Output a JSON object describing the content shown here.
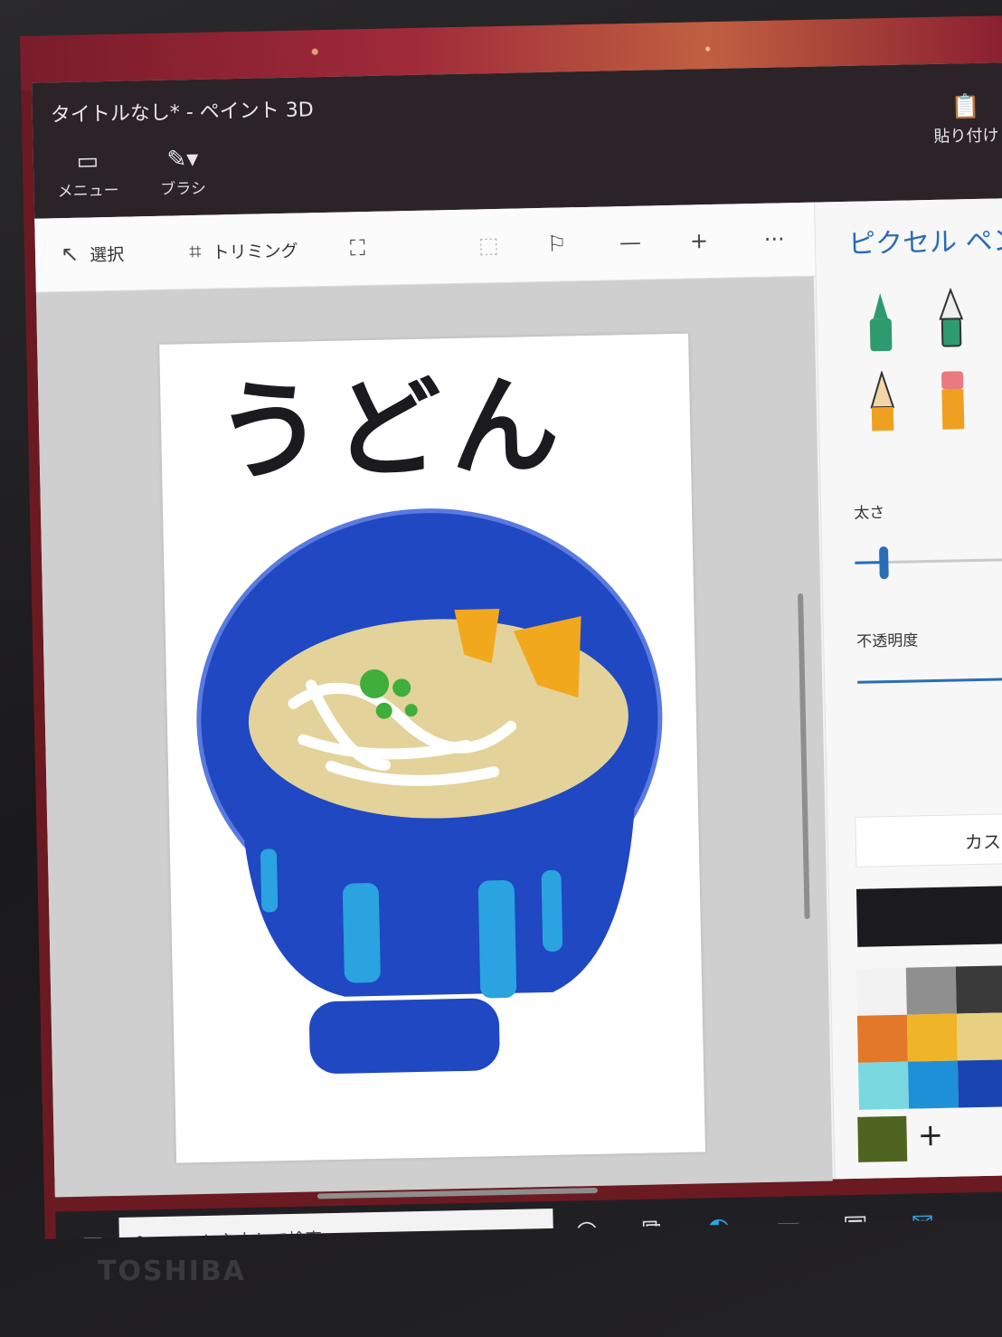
{
  "window": {
    "title": "タイトルなし* - ペイント 3D"
  },
  "ribbon": {
    "menu_label": "メニュー",
    "brush_label": "ブラシ",
    "paste_label": "貼り付け"
  },
  "toolbar": {
    "select_label": "選択",
    "crop_label": "トリミング",
    "more_label": "···"
  },
  "canvas": {
    "drawing_text": "うどん"
  },
  "panel": {
    "title": "ピクセル ペン",
    "thickness_label": "太さ",
    "opacity_label": "不透明度",
    "custom_label": "カスタ",
    "thickness_level": 0.15,
    "current_color": "#1a1a1f",
    "swatch_colors": [
      "#f2f2f2",
      "#8f8f8f",
      "#3a3a3a",
      "#111111",
      "#e3782a",
      "#f0b428",
      "#e8d080",
      "#e8d020",
      "#79d8e0",
      "#1e90d8",
      "#1a44b0",
      "#6a3aa0"
    ],
    "custom_swatch": "#4f6420",
    "add_label": "+"
  },
  "taskbar": {
    "search_placeholder": "ここに入力して検索"
  },
  "device": {
    "brand": "TOSHIBA"
  }
}
